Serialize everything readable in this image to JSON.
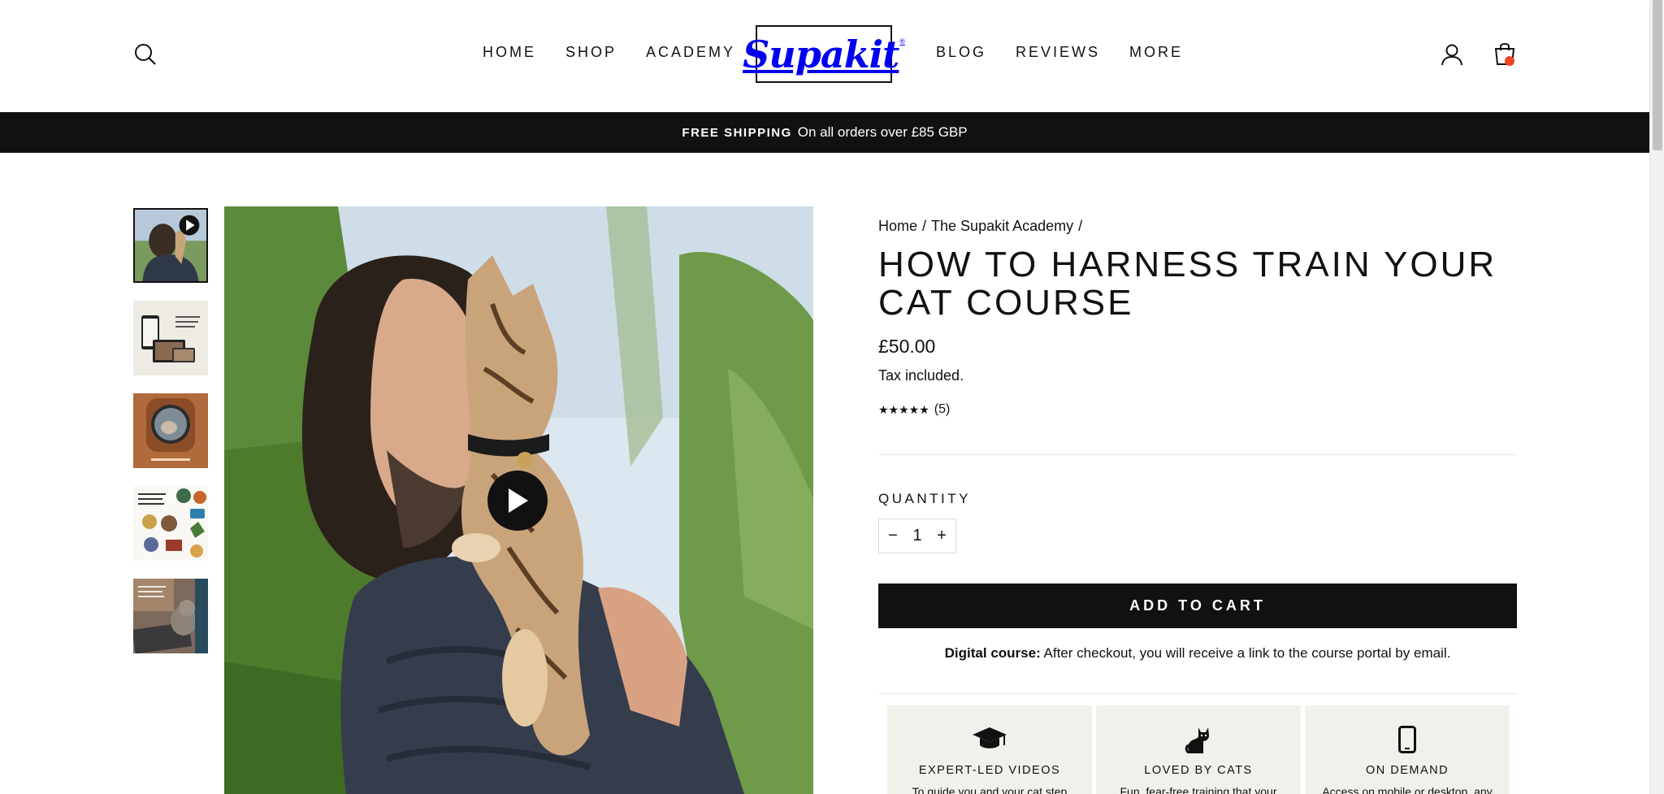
{
  "header": {
    "logo_text": "Supakit",
    "logo_mark": "®",
    "nav_left": [
      "HOME",
      "SHOP",
      "ACADEMY"
    ],
    "nav_right": [
      "BLOG",
      "REVIEWS",
      "MORE"
    ],
    "icons": {
      "search": "search-icon",
      "account": "user-icon",
      "cart": "shopping-bag-icon"
    },
    "cart_badge_color": "#f04423"
  },
  "announcement": {
    "bold": "FREE SHIPPING",
    "text": "On all orders over £85 GBP"
  },
  "gallery": {
    "thumbnails": [
      "video-thumbnail",
      "devices-thumbnail",
      "cat-backpack-thumbnail",
      "badges-thumbnail",
      "laptop-cat-thumbnail"
    ],
    "active_index": 0,
    "main_has_video": true
  },
  "product": {
    "breadcrumb": [
      "Home",
      "The Supakit Academy"
    ],
    "breadcrumb_sep": "/",
    "title": "HOW TO HARNESS TRAIN YOUR CAT COURSE",
    "price": "£50.00",
    "tax_note": "Tax included.",
    "stars": "★★★★★",
    "rating_count": "(5)",
    "quantity_label": "QUANTITY",
    "quantity_value": "1",
    "minus": "−",
    "plus": "+",
    "add_to_cart": "ADD TO CART",
    "digital_bold": "Digital course:",
    "digital_text": "After checkout, you will receive a link to the course portal by email."
  },
  "features": [
    {
      "icon": "graduation-cap-icon",
      "title": "EXPERT-LED VIDEOS",
      "desc": "To guide you and your cat step"
    },
    {
      "icon": "cat-icon",
      "title": "LOVED BY CATS",
      "desc": "Fun, fear-free training that your"
    },
    {
      "icon": "phone-icon",
      "title": "ON DEMAND",
      "desc": "Access on mobile or desktop, any"
    }
  ]
}
